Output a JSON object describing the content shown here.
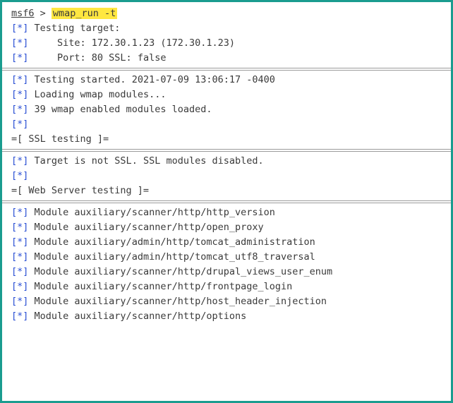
{
  "terminal": {
    "prompt_name": "msf6",
    "prompt_arrow": " > ",
    "command": "wmap_run -t",
    "marker": "[*]",
    "block1": [
      " Testing target:",
      "     Site: 172.30.1.23 (172.30.1.23)",
      "     Port: 80 SSL: false"
    ],
    "block2": [
      " Testing started. 2021-07-09 13:06:17 -0400",
      " Loading wmap modules...",
      " 39 wmap enabled modules loaded.",
      ""
    ],
    "ssl_header": "=[ SSL testing ]=",
    "block3": [
      " Target is not SSL. SSL modules disabled.",
      ""
    ],
    "web_header": "=[ Web Server testing ]=",
    "block4": [
      " Module auxiliary/scanner/http/http_version",
      " Module auxiliary/scanner/http/open_proxy",
      " Module auxiliary/admin/http/tomcat_administration",
      " Module auxiliary/admin/http/tomcat_utf8_traversal",
      " Module auxiliary/scanner/http/drupal_views_user_enum",
      " Module auxiliary/scanner/http/frontpage_login",
      " Module auxiliary/scanner/http/host_header_injection",
      " Module auxiliary/scanner/http/options"
    ]
  }
}
